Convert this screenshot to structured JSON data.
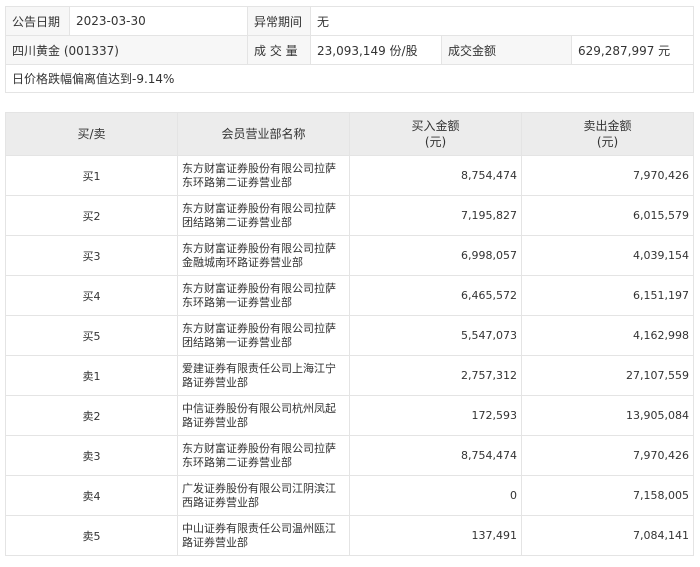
{
  "info": {
    "date_label": "公告日期",
    "date_value": "2023-03-30",
    "period_label": "异常期间",
    "period_value": "无",
    "stock_name": "四川黄金 (001337)",
    "volume_label": "成 交 量",
    "volume_value": "23,093,149 份/股",
    "amount_label": "成交金额",
    "amount_value": "629,287,997 元",
    "note": "日价格跌幅偏离值达到-9.14%"
  },
  "table": {
    "headers": {
      "side": "买/卖",
      "dept": "会员营业部名称",
      "buy": "买入金额",
      "buy_unit": "(元)",
      "sell": "卖出金额",
      "sell_unit": "(元)"
    },
    "rows": [
      {
        "side": "买1",
        "dept": "东方财富证券股份有限公司拉萨东环路第二证券营业部",
        "buy": "8,754,474",
        "sell": "7,970,426"
      },
      {
        "side": "买2",
        "dept": "东方财富证券股份有限公司拉萨团结路第二证券营业部",
        "buy": "7,195,827",
        "sell": "6,015,579"
      },
      {
        "side": "买3",
        "dept": "东方财富证券股份有限公司拉萨金融城南环路证券营业部",
        "buy": "6,998,057",
        "sell": "4,039,154"
      },
      {
        "side": "买4",
        "dept": "东方财富证券股份有限公司拉萨东环路第一证券营业部",
        "buy": "6,465,572",
        "sell": "6,151,197"
      },
      {
        "side": "买5",
        "dept": "东方财富证券股份有限公司拉萨团结路第一证券营业部",
        "buy": "5,547,073",
        "sell": "4,162,998"
      },
      {
        "side": "卖1",
        "dept": "爱建证券有限责任公司上海江宁路证券营业部",
        "buy": "2,757,312",
        "sell": "27,107,559"
      },
      {
        "side": "卖2",
        "dept": "中信证券股份有限公司杭州凤起路证券营业部",
        "buy": "172,593",
        "sell": "13,905,084"
      },
      {
        "side": "卖3",
        "dept": "东方财富证券股份有限公司拉萨东环路第二证券营业部",
        "buy": "8,754,474",
        "sell": "7,970,426"
      },
      {
        "side": "卖4",
        "dept": "广发证券股份有限公司江阴滨江西路证券营业部",
        "buy": "0",
        "sell": "7,158,005"
      },
      {
        "side": "卖5",
        "dept": "中山证券有限责任公司温州瓯江路证券营业部",
        "buy": "137,491",
        "sell": "7,084,141"
      }
    ]
  }
}
